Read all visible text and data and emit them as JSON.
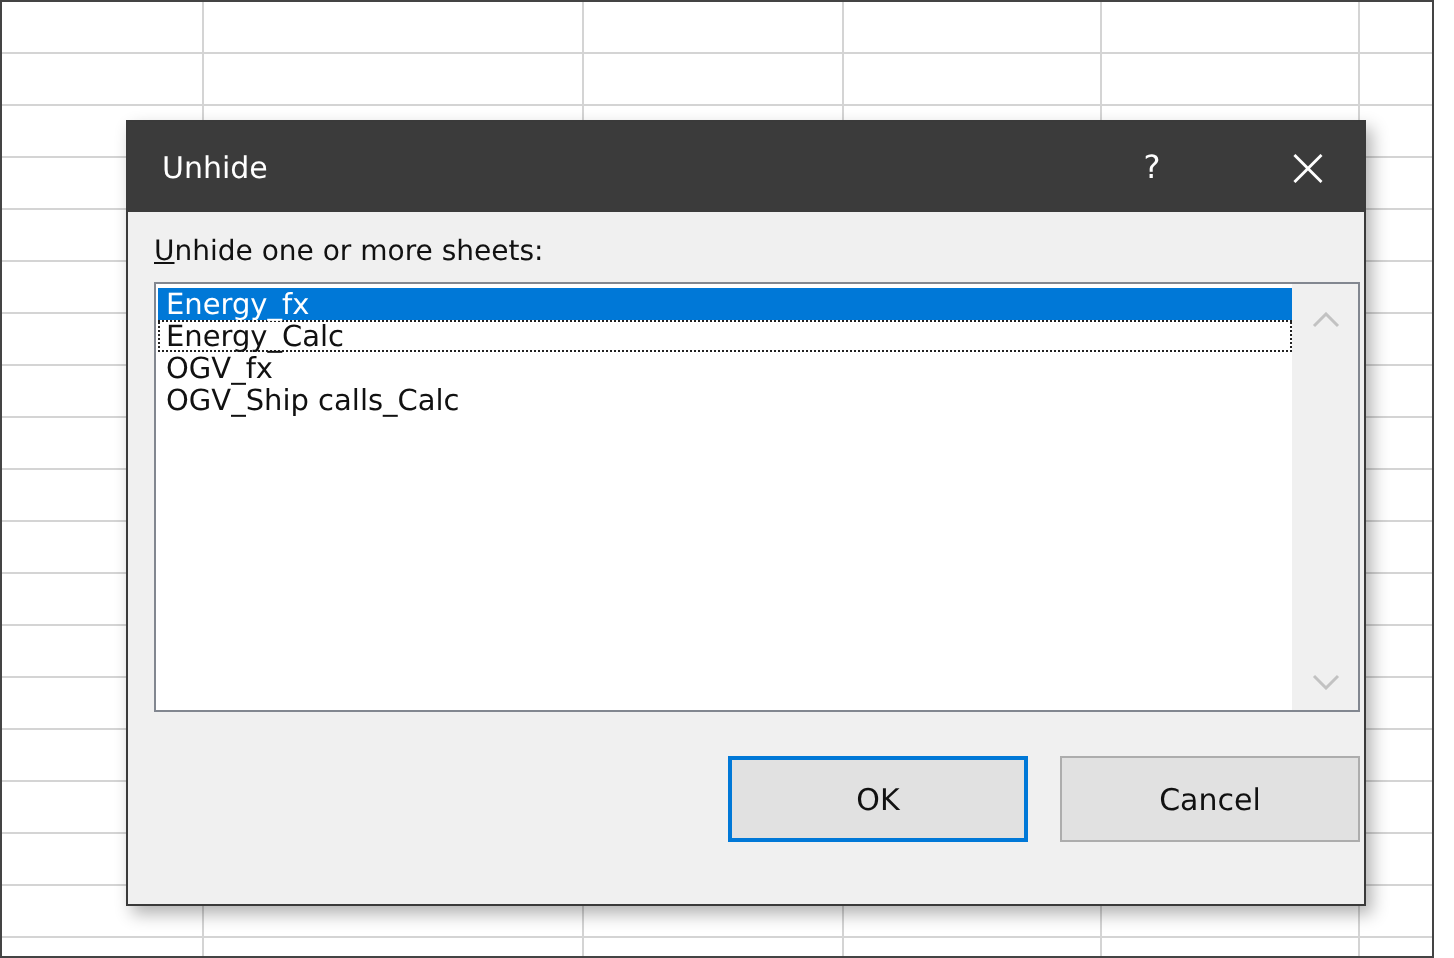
{
  "dialog": {
    "title": "Unhide",
    "help_button": "?",
    "close_button": "×",
    "prompt": "Unhide one or more sheets:",
    "sheets": [
      {
        "name": "Energy_fx",
        "selected": true,
        "focused": false
      },
      {
        "name": "Energy_Calc",
        "selected": false,
        "focused": true
      },
      {
        "name": "OGV_fx",
        "selected": false,
        "focused": false
      },
      {
        "name": "OGV_Ship calls_Calc",
        "selected": false,
        "focused": false
      }
    ],
    "buttons": [
      {
        "label": "OK",
        "default": true
      },
      {
        "label": "Cancel",
        "default": false
      }
    ]
  }
}
